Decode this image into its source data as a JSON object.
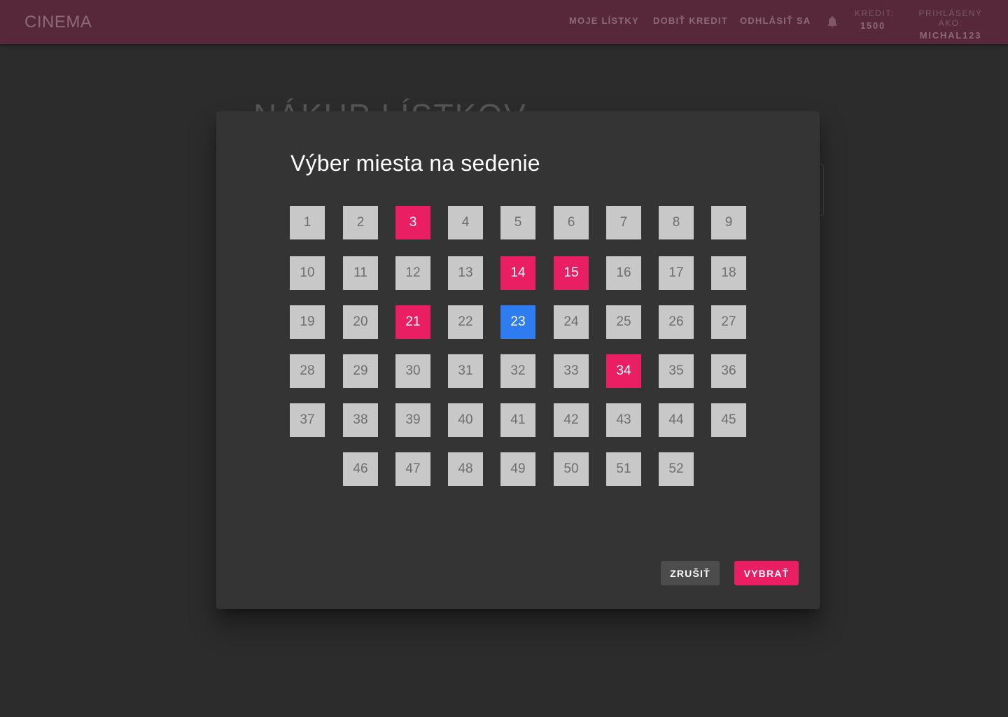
{
  "header": {
    "brand": "CINEMA",
    "nav": [
      "MOJE LÍSTKY",
      "DOBIŤ KREDIT",
      "ODHLÁSIŤ SA"
    ],
    "notifications_icon": "bell-icon",
    "credit_label": "KREDIT:",
    "credit_value": "1500",
    "user_label": "PRIHLÁSENÝ AKO:",
    "user_value": "MICHAL123"
  },
  "background": {
    "page_title": "NÁKUP LÍSTKOV"
  },
  "dialog": {
    "title": "Výber miesta na sedenie",
    "seat_rows": [
      [
        1,
        2,
        3,
        4,
        5,
        6,
        7,
        8,
        9
      ],
      [
        10,
        11,
        12,
        13,
        14,
        15,
        16,
        17,
        18
      ],
      [
        19,
        20,
        21,
        22,
        23,
        24,
        25,
        26,
        27
      ],
      [
        28,
        29,
        30,
        31,
        32,
        33,
        34,
        35,
        36
      ],
      [
        37,
        38,
        39,
        40,
        41,
        42,
        43,
        44,
        45
      ],
      [
        46,
        47,
        48,
        49,
        50,
        51,
        52
      ]
    ],
    "reserved_seats": [
      3,
      14,
      15,
      21,
      34
    ],
    "selected_seats": [
      23
    ],
    "cancel_label": "ZRUŠIŤ",
    "confirm_label": "VYBRAŤ"
  },
  "colors": {
    "appbar": "#56283a",
    "reserved": "#e91e63",
    "selected": "#2f7cf0",
    "free": "#c8c8c8"
  }
}
